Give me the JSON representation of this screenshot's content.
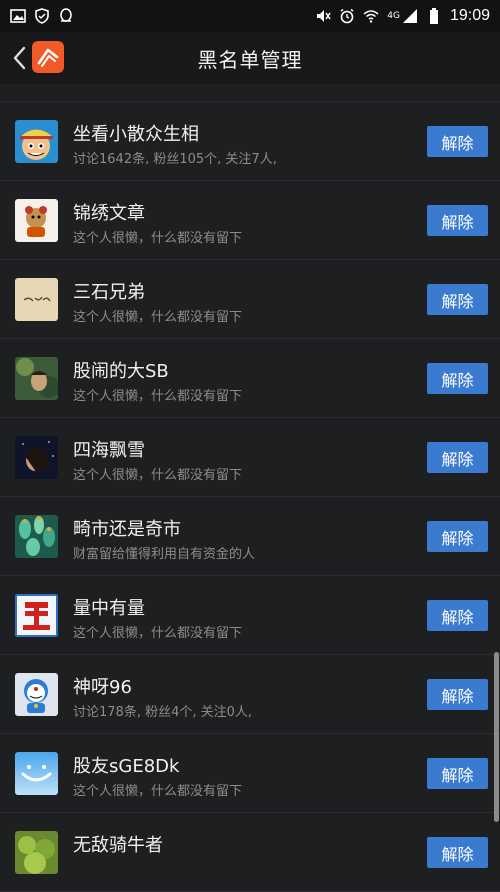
{
  "status": {
    "time": "19:09",
    "network": "4G",
    "left_icons": [
      "image-icon",
      "shield-icon",
      "qq-penguin-icon"
    ],
    "right_icons": [
      "mute-icon",
      "alarm-icon",
      "wifi-icon",
      "signal-icon",
      "battery-icon"
    ]
  },
  "header": {
    "title": "黑名单管理",
    "back_icon": "chevron-left-icon",
    "logo": "app-logo-icon"
  },
  "colors": {
    "background": "#1e1f21",
    "button": "#3b7bcf",
    "subtext": "#8c8c8c"
  },
  "blacklist": [
    {
      "name": "坐看小散众生相",
      "desc": "讨论1642条, 粉丝105个, 关注7人,",
      "button": "解除"
    },
    {
      "name": "锦绣文章",
      "desc": "这个人很懒，什么都没有留下",
      "button": "解除"
    },
    {
      "name": "三石兄弟",
      "desc": "这个人很懒，什么都没有留下",
      "button": "解除"
    },
    {
      "name": "股闹的大SB",
      "desc": "这个人很懒，什么都没有留下",
      "button": "解除"
    },
    {
      "name": "四海飘雪",
      "desc": "这个人很懒，什么都没有留下",
      "button": "解除"
    },
    {
      "name": "畸市还是奇市",
      "desc": "财富留给懂得利用自有资金的人",
      "button": "解除"
    },
    {
      "name": "量中有量",
      "desc": "这个人很懒，什么都没有留下",
      "button": "解除"
    },
    {
      "name": "神呀96",
      "desc": "讨论178条, 粉丝4个, 关注0人,",
      "button": "解除"
    },
    {
      "name": "股友sGE8Dk",
      "desc": "这个人很懒，什么都没有留下",
      "button": "解除"
    },
    {
      "name": "无敌骑牛者",
      "desc": "",
      "button": "解除"
    }
  ]
}
